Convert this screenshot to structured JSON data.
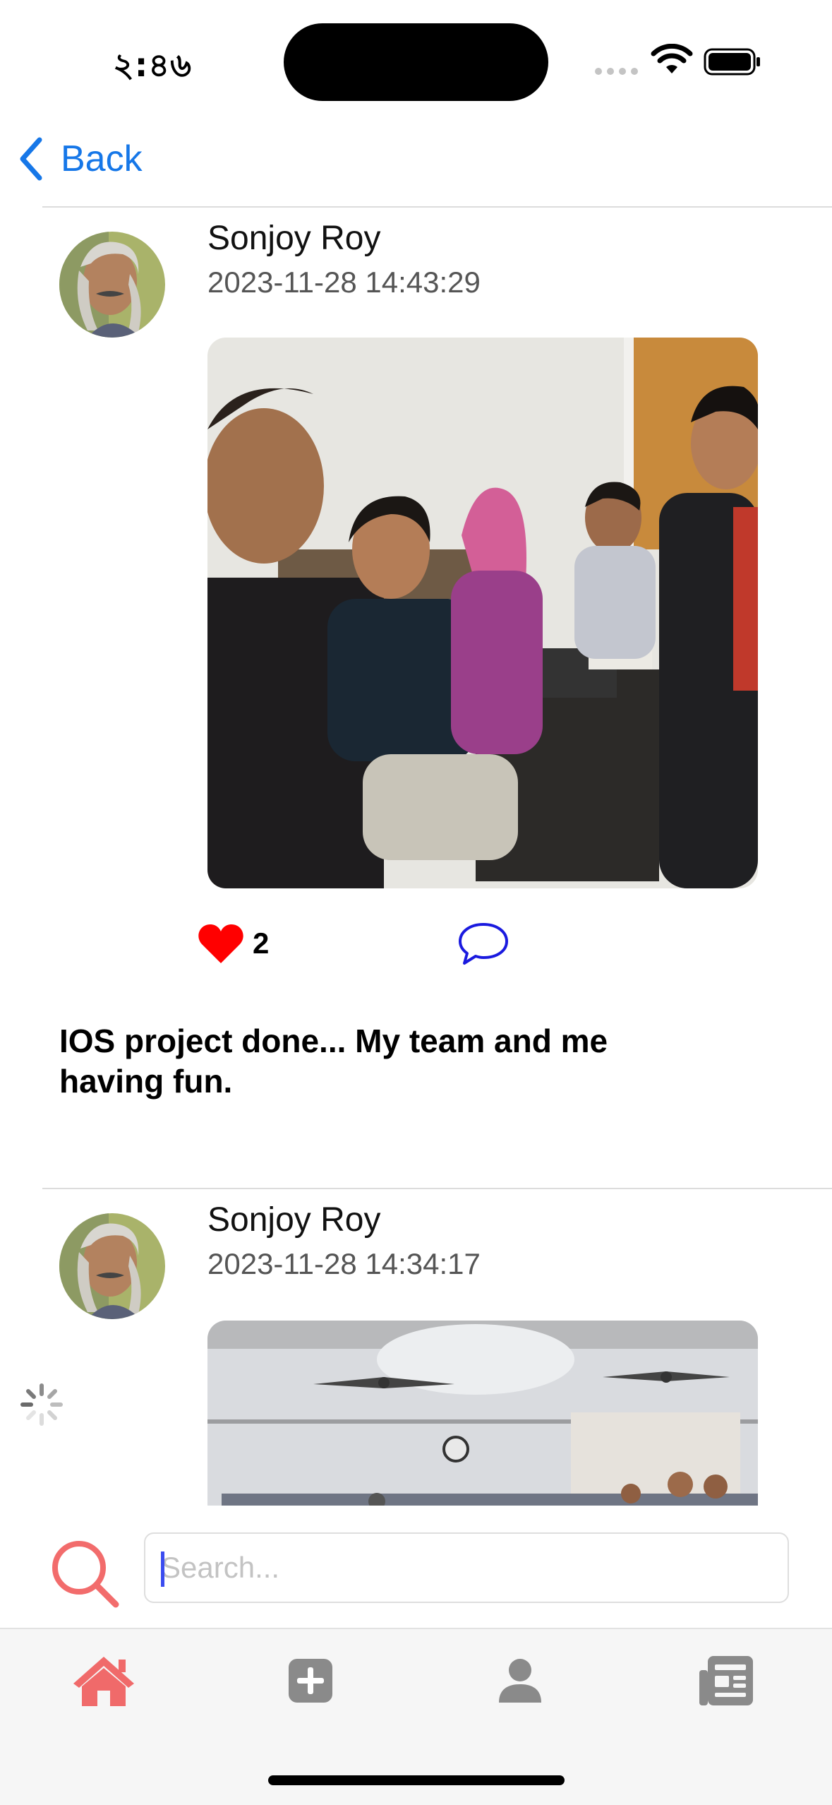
{
  "status_bar": {
    "time": "২:৪৬"
  },
  "nav": {
    "back_label": "Back"
  },
  "posts": [
    {
      "author": "Sonjoy Roy",
      "timestamp": "2023-11-28 14:43:29",
      "likes": "2",
      "caption": "IOS project done... My team and me having fun."
    },
    {
      "author": "Sonjoy Roy",
      "timestamp": "2023-11-28 14:34:17"
    }
  ],
  "search": {
    "placeholder": "Search..."
  },
  "tabs": [
    "home-icon",
    "add-post-icon",
    "profile-icon",
    "news-icon"
  ],
  "colors": {
    "accent": "#1677e8",
    "tab_active": "#f06a6a",
    "tab_inactive": "#8a8a8a",
    "like": "#ff0000",
    "comment": "#1a1adf"
  }
}
